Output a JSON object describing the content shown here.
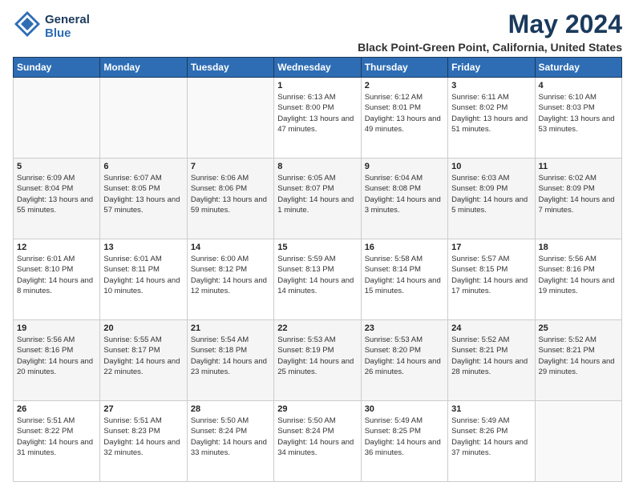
{
  "logo": {
    "general": "General",
    "blue": "Blue",
    "tagline": ""
  },
  "header": {
    "title": "May 2024",
    "subtitle": "Black Point-Green Point, California, United States"
  },
  "days_of_week": [
    "Sunday",
    "Monday",
    "Tuesday",
    "Wednesday",
    "Thursday",
    "Friday",
    "Saturday"
  ],
  "weeks": [
    [
      {
        "day": "",
        "info": ""
      },
      {
        "day": "",
        "info": ""
      },
      {
        "day": "",
        "info": ""
      },
      {
        "day": "1",
        "info": "Sunrise: 6:13 AM\nSunset: 8:00 PM\nDaylight: 13 hours\nand 47 minutes."
      },
      {
        "day": "2",
        "info": "Sunrise: 6:12 AM\nSunset: 8:01 PM\nDaylight: 13 hours\nand 49 minutes."
      },
      {
        "day": "3",
        "info": "Sunrise: 6:11 AM\nSunset: 8:02 PM\nDaylight: 13 hours\nand 51 minutes."
      },
      {
        "day": "4",
        "info": "Sunrise: 6:10 AM\nSunset: 8:03 PM\nDaylight: 13 hours\nand 53 minutes."
      }
    ],
    [
      {
        "day": "5",
        "info": "Sunrise: 6:09 AM\nSunset: 8:04 PM\nDaylight: 13 hours\nand 55 minutes."
      },
      {
        "day": "6",
        "info": "Sunrise: 6:07 AM\nSunset: 8:05 PM\nDaylight: 13 hours\nand 57 minutes."
      },
      {
        "day": "7",
        "info": "Sunrise: 6:06 AM\nSunset: 8:06 PM\nDaylight: 13 hours\nand 59 minutes."
      },
      {
        "day": "8",
        "info": "Sunrise: 6:05 AM\nSunset: 8:07 PM\nDaylight: 14 hours\nand 1 minute."
      },
      {
        "day": "9",
        "info": "Sunrise: 6:04 AM\nSunset: 8:08 PM\nDaylight: 14 hours\nand 3 minutes."
      },
      {
        "day": "10",
        "info": "Sunrise: 6:03 AM\nSunset: 8:09 PM\nDaylight: 14 hours\nand 5 minutes."
      },
      {
        "day": "11",
        "info": "Sunrise: 6:02 AM\nSunset: 8:09 PM\nDaylight: 14 hours\nand 7 minutes."
      }
    ],
    [
      {
        "day": "12",
        "info": "Sunrise: 6:01 AM\nSunset: 8:10 PM\nDaylight: 14 hours\nand 8 minutes."
      },
      {
        "day": "13",
        "info": "Sunrise: 6:01 AM\nSunset: 8:11 PM\nDaylight: 14 hours\nand 10 minutes."
      },
      {
        "day": "14",
        "info": "Sunrise: 6:00 AM\nSunset: 8:12 PM\nDaylight: 14 hours\nand 12 minutes."
      },
      {
        "day": "15",
        "info": "Sunrise: 5:59 AM\nSunset: 8:13 PM\nDaylight: 14 hours\nand 14 minutes."
      },
      {
        "day": "16",
        "info": "Sunrise: 5:58 AM\nSunset: 8:14 PM\nDaylight: 14 hours\nand 15 minutes."
      },
      {
        "day": "17",
        "info": "Sunrise: 5:57 AM\nSunset: 8:15 PM\nDaylight: 14 hours\nand 17 minutes."
      },
      {
        "day": "18",
        "info": "Sunrise: 5:56 AM\nSunset: 8:16 PM\nDaylight: 14 hours\nand 19 minutes."
      }
    ],
    [
      {
        "day": "19",
        "info": "Sunrise: 5:56 AM\nSunset: 8:16 PM\nDaylight: 14 hours\nand 20 minutes."
      },
      {
        "day": "20",
        "info": "Sunrise: 5:55 AM\nSunset: 8:17 PM\nDaylight: 14 hours\nand 22 minutes."
      },
      {
        "day": "21",
        "info": "Sunrise: 5:54 AM\nSunset: 8:18 PM\nDaylight: 14 hours\nand 23 minutes."
      },
      {
        "day": "22",
        "info": "Sunrise: 5:53 AM\nSunset: 8:19 PM\nDaylight: 14 hours\nand 25 minutes."
      },
      {
        "day": "23",
        "info": "Sunrise: 5:53 AM\nSunset: 8:20 PM\nDaylight: 14 hours\nand 26 minutes."
      },
      {
        "day": "24",
        "info": "Sunrise: 5:52 AM\nSunset: 8:21 PM\nDaylight: 14 hours\nand 28 minutes."
      },
      {
        "day": "25",
        "info": "Sunrise: 5:52 AM\nSunset: 8:21 PM\nDaylight: 14 hours\nand 29 minutes."
      }
    ],
    [
      {
        "day": "26",
        "info": "Sunrise: 5:51 AM\nSunset: 8:22 PM\nDaylight: 14 hours\nand 31 minutes."
      },
      {
        "day": "27",
        "info": "Sunrise: 5:51 AM\nSunset: 8:23 PM\nDaylight: 14 hours\nand 32 minutes."
      },
      {
        "day": "28",
        "info": "Sunrise: 5:50 AM\nSunset: 8:24 PM\nDaylight: 14 hours\nand 33 minutes."
      },
      {
        "day": "29",
        "info": "Sunrise: 5:50 AM\nSunset: 8:24 PM\nDaylight: 14 hours\nand 34 minutes."
      },
      {
        "day": "30",
        "info": "Sunrise: 5:49 AM\nSunset: 8:25 PM\nDaylight: 14 hours\nand 36 minutes."
      },
      {
        "day": "31",
        "info": "Sunrise: 5:49 AM\nSunset: 8:26 PM\nDaylight: 14 hours\nand 37 minutes."
      },
      {
        "day": "",
        "info": ""
      }
    ]
  ]
}
